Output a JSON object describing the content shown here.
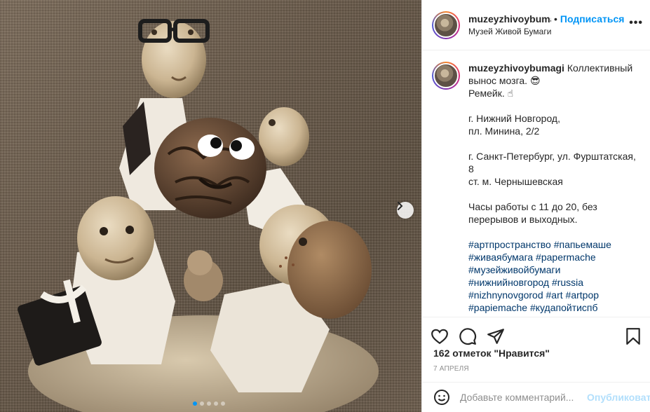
{
  "post": {
    "username": "muzeyzhivoybumagi",
    "follow_label": "Подписаться",
    "bullet": "•",
    "location": "Музей Живой Бумаги",
    "more_label": "•••",
    "caption_lines": [
      "Коллективный",
      "вынос мозга. 😎",
      "Ремейк. ☝",
      "",
      "г. Нижний Новгород,",
      "пл. Минина, 2/2",
      "",
      "г. Санкт-Петербург, ул. Фурштатская,",
      "8",
      "ст. м. Чернышевская",
      "",
      "Часы работы с 11 до 20, без",
      "перерывов и выходных.",
      ""
    ],
    "hashtags": [
      "#артпространство #папьемаше",
      "#живаябумага #papermache",
      "#музейживойбумаги",
      "#нижнийновгород #russia",
      "#nizhnynovgorod #art #artpop",
      "#papiemache #куда­пойтиспб"
    ],
    "likes": "162 отметок \"Нравится\"",
    "date": "7 АПРЕЛЯ",
    "comment_placeholder": "Добавьте комментарий...",
    "publish_label": "Опубликовать"
  },
  "carousel": {
    "slide_index": 1,
    "slide_count": 5
  },
  "icons": {
    "like": "heart-icon",
    "comment": "comment-icon",
    "share": "paper-plane-icon",
    "save": "bookmark-icon",
    "emoji": "smile-icon",
    "next": "chevron-right-icon"
  },
  "colors": {
    "accent": "#0095f6",
    "text": "#262626",
    "muted": "#8e8e8e",
    "link": "#00376b"
  }
}
